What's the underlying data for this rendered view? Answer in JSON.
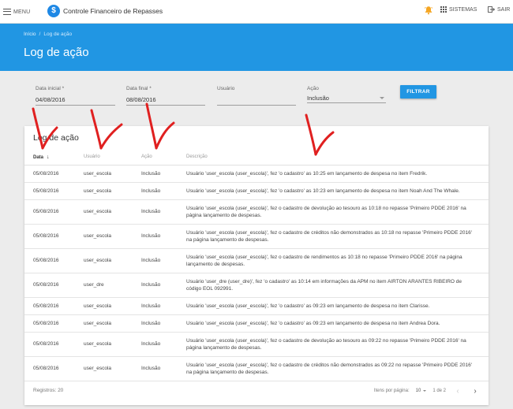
{
  "topbar": {
    "menu_label": "MENU",
    "logo_glyph": "$",
    "app_title": "Controle Financeiro de Repasses",
    "bell_icon": "bell-icon",
    "sistemas_label": "SISTEMAS",
    "sair_label": "SAIR"
  },
  "header": {
    "breadcrumb": [
      "Início",
      "/",
      "Log de ação"
    ],
    "title": "Log de ação"
  },
  "filters": {
    "data_inicial": {
      "label": "Data inicial",
      "required": "*",
      "value": "04/08/2016"
    },
    "data_final": {
      "label": "Data final",
      "required": "*",
      "value": "08/08/2016"
    },
    "usuario": {
      "label": "Usuário",
      "value": ""
    },
    "acao": {
      "label": "Ação",
      "value": "Inclusão"
    },
    "button_label": "FILTRAR"
  },
  "log": {
    "title": "Log de ação",
    "columns": [
      "Data",
      "Usuário",
      "Ação",
      "Descrição"
    ],
    "sort_arrow": "↓",
    "rows": [
      {
        "data": "05/08/2016",
        "usuario": "user_escola",
        "acao": "Inclusão",
        "descricao": "Usuário 'user_escola (user_escola)', fez 'o cadastro' as 10:25 em lançamento de despesa no item Fredrik."
      },
      {
        "data": "05/08/2016",
        "usuario": "user_escola",
        "acao": "Inclusão",
        "descricao": "Usuário 'user_escola (user_escola)', fez 'o cadastro' as 10:23 em lançamento de despesa no item Noah And The Whale."
      },
      {
        "data": "05/08/2016",
        "usuario": "user_escola",
        "acao": "Inclusão",
        "descricao": "Usuário 'user_escola (user_escola)', fez o cadastro de devolução ao tesouro as 10:18 no repasse 'Primeiro PDDE 2016' na página lançamento de despesas."
      },
      {
        "data": "05/08/2016",
        "usuario": "user_escola",
        "acao": "Inclusão",
        "descricao": "Usuário 'user_escola (user_escola)', fez o cadastro de créditos não demonstrados as 10:18 no repasse 'Primeiro PDDE 2016' na página lançamento de despesas."
      },
      {
        "data": "05/08/2016",
        "usuario": "user_escola",
        "acao": "Inclusão",
        "descricao": "Usuário 'user_escola (user_escola)', fez o cadastro de rendimentos as 10:18 no repasse 'Primeiro PDDE 2016' na página lançamento de despesas."
      },
      {
        "data": "05/08/2016",
        "usuario": "user_dre",
        "acao": "Inclusão",
        "descricao": "Usuário 'user_dre (user_dre)', fez 'o cadastro' as 10:14 em informações da APM no item AIRTON ARANTES RIBEIRO de código EOL 092991."
      },
      {
        "data": "05/08/2016",
        "usuario": "user_escola",
        "acao": "Inclusão",
        "descricao": "Usuário 'user_escola (user_escola)', fez 'o cadastro' as 09:23 em lançamento de despesa no item Clarisse."
      },
      {
        "data": "05/08/2016",
        "usuario": "user_escola",
        "acao": "Inclusão",
        "descricao": "Usuário 'user_escola (user_escola)', fez 'o cadastro' as 09:23 em lançamento de despesa no item Andrea Dora."
      },
      {
        "data": "05/08/2016",
        "usuario": "user_escola",
        "acao": "Inclusão",
        "descricao": "Usuário 'user_escola (user_escola)', fez o cadastro de devolução ao tesouro as 09:22 no repasse 'Primeiro PDDE 2016' na página lançamento de despesas."
      },
      {
        "data": "05/08/2016",
        "usuario": "user_escola",
        "acao": "Inclusão",
        "descricao": "Usuário 'user_escola (user_escola)', fez o cadastro de créditos não demonstrados as 09:22 no repasse 'Primeiro PDDE 2016' na página lançamento de despesas."
      }
    ],
    "registros": "Registros: 20",
    "itens_por_pagina_label": "Itens por página:",
    "itens_por_pagina_value": "10",
    "page_range": "1 de 2"
  },
  "colors": {
    "primary": "#2196e3",
    "annotation": "#e02020"
  }
}
